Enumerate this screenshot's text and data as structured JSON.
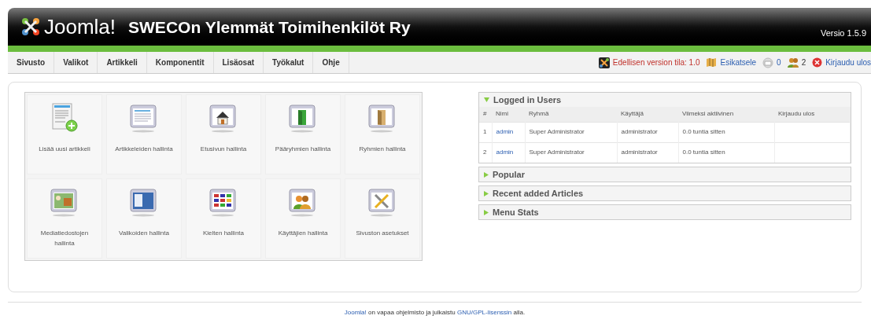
{
  "header": {
    "logo_text": "Joomla!",
    "site_title": "SWECOn Ylemmät Toimihenkilöt Ry",
    "version": "Versio 1.5.9"
  },
  "menu": [
    {
      "label": "Sivusto"
    },
    {
      "label": "Valikot"
    },
    {
      "label": "Artikkeli"
    },
    {
      "label": "Komponentit"
    },
    {
      "label": "Lisäosat"
    },
    {
      "label": "Työkalut"
    },
    {
      "label": "Ohje"
    }
  ],
  "status": [
    {
      "kind": "version",
      "label": "Edellisen version tila: 1.0"
    },
    {
      "kind": "preview",
      "label": "Esikatsele"
    },
    {
      "kind": "messages",
      "label": "0"
    },
    {
      "kind": "users",
      "label": "2"
    },
    {
      "kind": "logout",
      "label": "Kirjaudu ulos"
    }
  ],
  "quick_icons": [
    {
      "kind": "add-article",
      "label": "Lisää uusi artikkeli"
    },
    {
      "kind": "articles",
      "label": "Artikkeleiden hallinta"
    },
    {
      "kind": "home",
      "label": "Etusivun hallinta"
    },
    {
      "kind": "folder-green",
      "label": "Pääryhmien hallinta"
    },
    {
      "kind": "folder-tan",
      "label": "Ryhmien hallinta"
    },
    {
      "kind": "media",
      "label": "Mediatiedostojen hallinta"
    },
    {
      "kind": "menus",
      "label": "Valikoiden hallinta"
    },
    {
      "kind": "flags",
      "label": "Kielten hallinta"
    },
    {
      "kind": "users",
      "label": "Käyttäjien hallinta"
    },
    {
      "kind": "tools",
      "label": "Sivuston asetukset"
    }
  ],
  "panels": [
    {
      "title": "Logged in Users",
      "expanded": true,
      "table": {
        "columns": [
          "#",
          "Nimi",
          "Ryhmä",
          "Käyttäjä",
          "Viimeksi aktiivinen",
          "Kirjaudu ulos"
        ],
        "rows": [
          [
            "1",
            "admin",
            "Super Administrator",
            "administrator",
            "0.0 tuntia sitten"
          ],
          [
            "2",
            "admin",
            "Super Administrator",
            "administrator",
            "0.0 tuntia sitten"
          ]
        ]
      }
    },
    {
      "title": "Popular",
      "expanded": false
    },
    {
      "title": "Recent added Articles",
      "expanded": false
    },
    {
      "title": "Menu Stats",
      "expanded": false
    }
  ],
  "footer": [
    {
      "kind": "link",
      "text": "Joomla!"
    },
    {
      "kind": "text",
      "text": " on vapaa ohjelmisto ja julkaistu "
    },
    {
      "kind": "link",
      "text": "GNU/GPL-lisenssin"
    },
    {
      "kind": "text",
      "text": " alla."
    }
  ]
}
